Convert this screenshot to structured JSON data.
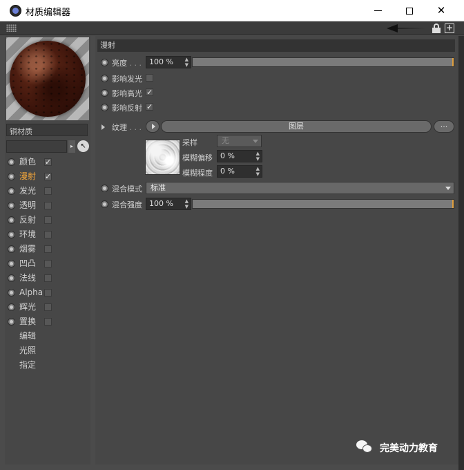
{
  "window": {
    "title": "材质编辑器",
    "min_icon": "minimize-icon",
    "max_icon": "maximize-icon",
    "close_glyph": "✕"
  },
  "toolbar": {
    "newwin_glyph": "+"
  },
  "left": {
    "material_name": "铜材质",
    "search_arrow": "▸",
    "pick_glyph": "↖",
    "channels": [
      {
        "label": "颜色",
        "checked": true,
        "active": false
      },
      {
        "label": "漫射",
        "checked": true,
        "active": true
      },
      {
        "label": "发光",
        "checked": false,
        "active": false
      },
      {
        "label": "透明",
        "checked": false,
        "active": false
      },
      {
        "label": "反射",
        "checked": false,
        "active": false
      },
      {
        "label": "环境",
        "checked": false,
        "active": false
      },
      {
        "label": "烟雾",
        "checked": false,
        "active": false
      },
      {
        "label": "凹凸",
        "checked": false,
        "active": false
      },
      {
        "label": "法线",
        "checked": false,
        "active": false
      },
      {
        "label": "Alpha",
        "checked": false,
        "active": false
      },
      {
        "label": "辉光",
        "checked": false,
        "active": false
      },
      {
        "label": "置换",
        "checked": false,
        "active": false
      }
    ],
    "extra_items": [
      "编辑",
      "光照",
      "指定"
    ],
    "check_glyph": "✓"
  },
  "diffuse": {
    "section_title": "漫射",
    "brightness_label": "亮度",
    "brightness_dots": ". . .",
    "brightness_value": "100 %",
    "brightness_fraction": 1.0,
    "affect_luminance_label": "影响发光",
    "affect_luminance_checked": false,
    "affect_specular_label": "影响高光",
    "affect_specular_checked": true,
    "affect_reflection_label": "影响反射",
    "affect_reflection_checked": true,
    "texture_label": "纹理",
    "texture_dots": ". . .",
    "layer_button": "图层",
    "more_button": "...",
    "sampling_label": "采样",
    "sampling_value": "无",
    "blur_offset_label": "模糊偏移",
    "blur_offset_value": "0 %",
    "blur_scale_label": "模糊程度",
    "blur_scale_value": "0 %",
    "mix_mode_label": "混合模式",
    "mix_mode_value": "标准",
    "mix_strength_label": "混合强度",
    "mix_strength_value": "100 %",
    "mix_strength_fraction": 1.0,
    "spin_glyph": "▲▼"
  },
  "watermark": {
    "text": "完美动力教育"
  },
  "colors": {
    "active_channel": "#f0a43a",
    "panel_bg": "#474747",
    "slider_end": "#e0a040"
  }
}
